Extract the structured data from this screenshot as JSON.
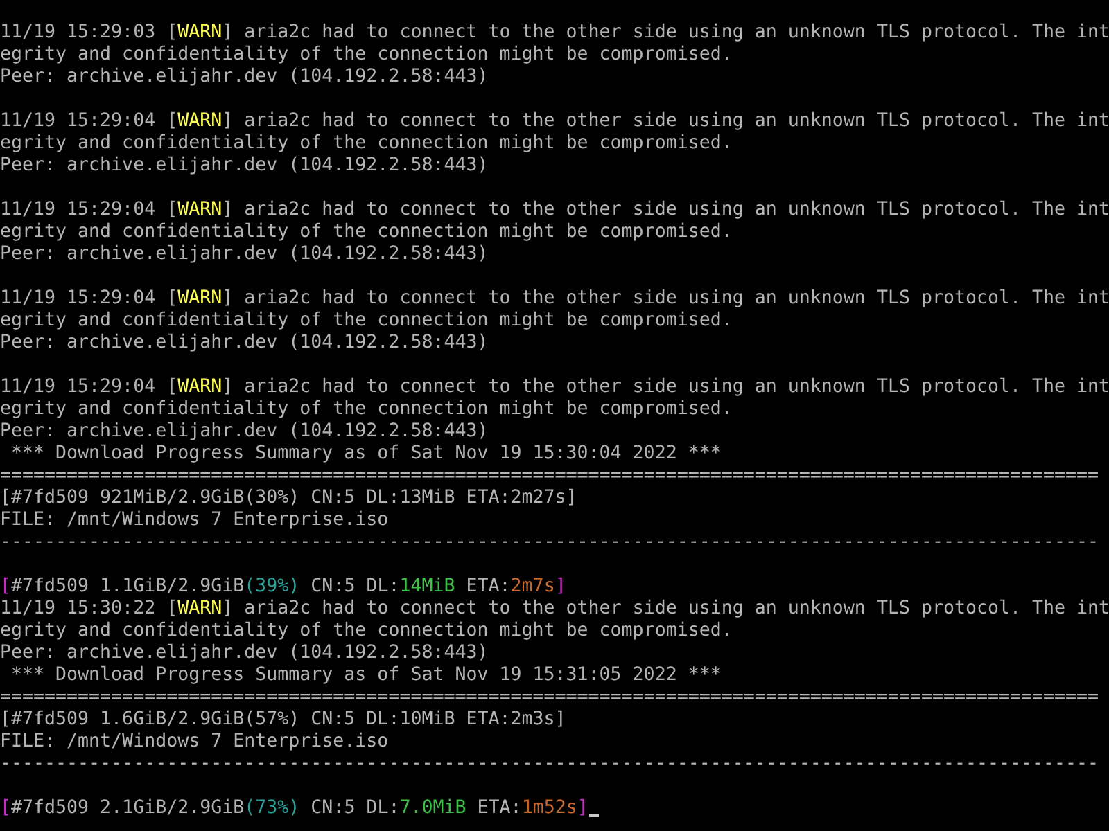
{
  "lines": [
    {
      "kind": "warn",
      "time": "11/19 15:29:03",
      "open": "[",
      "tag": "WARN",
      "close": "]",
      "message": "aria2c had to connect to the other side using an unknown TLS protocol. The int",
      "continuation": "egrity and confidentiality of the connection might be compromised.",
      "peer": "Peer: archive.elijahr.dev (104.192.2.58:443)"
    },
    {
      "kind": "blank"
    },
    {
      "kind": "warn",
      "time": "11/19 15:29:04",
      "open": "[",
      "tag": "WARN",
      "close": "]",
      "message": "aria2c had to connect to the other side using an unknown TLS protocol. The int",
      "continuation": "egrity and confidentiality of the connection might be compromised.",
      "peer": "Peer: archive.elijahr.dev (104.192.2.58:443)"
    },
    {
      "kind": "blank"
    },
    {
      "kind": "warn",
      "time": "11/19 15:29:04",
      "open": "[",
      "tag": "WARN",
      "close": "]",
      "message": "aria2c had to connect to the other side using an unknown TLS protocol. The int",
      "continuation": "egrity and confidentiality of the connection might be compromised.",
      "peer": "Peer: archive.elijahr.dev (104.192.2.58:443)"
    },
    {
      "kind": "blank"
    },
    {
      "kind": "warn",
      "time": "11/19 15:29:04",
      "open": "[",
      "tag": "WARN",
      "close": "]",
      "message": "aria2c had to connect to the other side using an unknown TLS protocol. The int",
      "continuation": "egrity and confidentiality of the connection might be compromised.",
      "peer": "Peer: archive.elijahr.dev (104.192.2.58:443)"
    },
    {
      "kind": "blank"
    },
    {
      "kind": "warn",
      "time": "11/19 15:29:04",
      "open": "[",
      "tag": "WARN",
      "close": "]",
      "message": "aria2c had to connect to the other side using an unknown TLS protocol. The int",
      "continuation": "egrity and confidentiality of the connection might be compromised.",
      "peer": "Peer: archive.elijahr.dev (104.192.2.58:443)"
    },
    {
      "kind": "summary",
      "title": "*** Download Progress Summary as of Sat Nov 19 15:30:04 2022 ***",
      "separator": "===================================================================================================",
      "status": "[#7fd509 921MiB/2.9GiB(30%) CN:5 DL:13MiB ETA:2m27s]",
      "file": "FILE: /mnt/Windows 7 Enterprise.iso",
      "rule": "---------------------------------------------------------------------------------------------------"
    },
    {
      "kind": "blank"
    },
    {
      "kind": "progress",
      "open": "[",
      "gid": "#7fd509",
      "size": "1.1GiB/2.9GiB",
      "percent": "(39%)",
      "connections": "CN:5",
      "dl_label": "DL:",
      "dl": "14MiB",
      "eta_label": "ETA:",
      "eta": "2m7s",
      "close": "]",
      "cursor": false
    },
    {
      "kind": "warn",
      "time": "11/19 15:30:22",
      "open": "[",
      "tag": "WARN",
      "close": "]",
      "message": "aria2c had to connect to the other side using an unknown TLS protocol. The int",
      "continuation": "egrity and confidentiality of the connection might be compromised.",
      "peer": "Peer: archive.elijahr.dev (104.192.2.58:443)"
    },
    {
      "kind": "summary",
      "title": "*** Download Progress Summary as of Sat Nov 19 15:31:05 2022 ***",
      "separator": "===================================================================================================",
      "status": "[#7fd509 1.6GiB/2.9GiB(57%) CN:5 DL:10MiB ETA:2m3s]",
      "file": "FILE: /mnt/Windows 7 Enterprise.iso",
      "rule": "---------------------------------------------------------------------------------------------------"
    },
    {
      "kind": "blank"
    },
    {
      "kind": "progress",
      "open": "[",
      "gid": "#7fd509",
      "size": "2.1GiB/2.9GiB",
      "percent": "(73%)",
      "connections": "CN:5",
      "dl_label": "DL:",
      "dl": "7.0MiB",
      "eta_label": "ETA:",
      "eta": "1m52s",
      "close": "]",
      "cursor": true
    }
  ]
}
